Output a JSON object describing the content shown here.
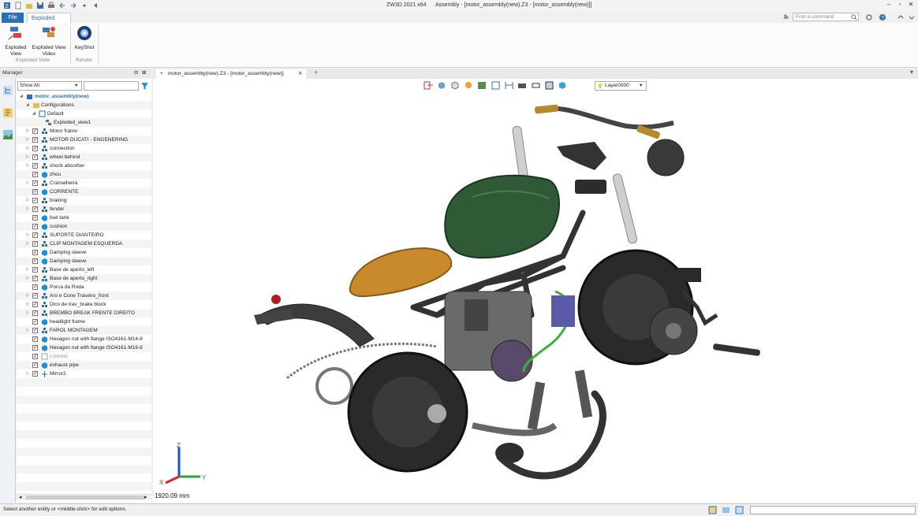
{
  "window": {
    "app_title": "ZW3D 2021 x64",
    "doc_title": "Assembly - [motor_assembly(new).Z3 - [motor_assembly(new)]]"
  },
  "ribbon": {
    "tabs": [
      {
        "label": "File"
      },
      {
        "label": "Exploded View"
      }
    ],
    "search_placeholder": "Find a command",
    "buttons": [
      {
        "label": "Exploded View View"
      },
      {
        "label": "Exploded View Video"
      },
      {
        "label": "KeyShot"
      }
    ],
    "btn1_line1": "Exploded",
    "btn1_line2": "View",
    "btn2_line1": "Exploded View",
    "btn2_line2": "Video",
    "btn3_line1": "KeyShot",
    "groups": [
      {
        "label": "Exploded View"
      },
      {
        "label": "Render"
      }
    ]
  },
  "manager": {
    "title": "Manager",
    "filter_value": "Show All",
    "tree": [
      {
        "label": "motor_assembly(new)",
        "level": 0,
        "check": false,
        "icon": "assembly-root-icon",
        "expand": "open"
      },
      {
        "label": "Configurations",
        "level": 1,
        "check": false,
        "icon": "folder-icon",
        "expand": "open"
      },
      {
        "label": "Default",
        "level": 2,
        "check": false,
        "icon": "config-icon",
        "expand": "open"
      },
      {
        "label": "Exploded_view1",
        "level": 3,
        "check": false,
        "icon": "exploded-view-icon",
        "expand": "none"
      },
      {
        "label": "Motor frame",
        "level": 1,
        "check": true,
        "icon": "subassembly-icon",
        "expand": "closed"
      },
      {
        "label": "MOTOR DUCATI - ENGENERING",
        "level": 1,
        "check": true,
        "icon": "subassembly-icon",
        "expand": "closed"
      },
      {
        "label": "connection",
        "level": 1,
        "check": true,
        "icon": "subassembly-icon",
        "expand": "closed"
      },
      {
        "label": "wheel behind",
        "level": 1,
        "check": true,
        "icon": "subassembly-icon",
        "expand": "closed"
      },
      {
        "label": "shock absorber",
        "level": 1,
        "check": true,
        "icon": "subassembly-icon",
        "expand": "closed"
      },
      {
        "label": "zhou",
        "level": 1,
        "check": true,
        "icon": "part-icon",
        "expand": "none"
      },
      {
        "label": "Cramalheira",
        "level": 1,
        "check": true,
        "icon": "subassembly-icon",
        "expand": "closed"
      },
      {
        "label": "CORRENTE",
        "level": 1,
        "check": true,
        "icon": "part-icon",
        "expand": "none"
      },
      {
        "label": "braking",
        "level": 1,
        "check": true,
        "icon": "subassembly-icon",
        "expand": "closed"
      },
      {
        "label": "fender",
        "level": 1,
        "check": true,
        "icon": "subassembly-icon",
        "expand": "closed"
      },
      {
        "label": "fuel tank",
        "level": 1,
        "check": true,
        "icon": "part-icon",
        "expand": "none"
      },
      {
        "label": "cushion",
        "level": 1,
        "check": true,
        "icon": "part-icon",
        "expand": "none"
      },
      {
        "label": "SUPORTE DIANTEIRO",
        "level": 1,
        "check": true,
        "icon": "subassembly-icon",
        "expand": "closed"
      },
      {
        "label": "CLIP MONTAGEM ESQUERDA",
        "level": 1,
        "check": true,
        "icon": "subassembly-icon",
        "expand": "closed"
      },
      {
        "label": "Damping sleeve",
        "level": 1,
        "check": true,
        "icon": "part-icon",
        "expand": "none"
      },
      {
        "label": "Damping sleeve",
        "level": 1,
        "check": true,
        "icon": "part-icon",
        "expand": "none"
      },
      {
        "label": "Base de aperto_left",
        "level": 1,
        "check": true,
        "icon": "subassembly-icon",
        "expand": "closed"
      },
      {
        "label": "Base de aperto_right",
        "level": 1,
        "check": true,
        "icon": "subassembly-icon",
        "expand": "closed"
      },
      {
        "label": "Porca da Roda",
        "level": 1,
        "check": true,
        "icon": "part-icon",
        "expand": "none"
      },
      {
        "label": "Aro e Cone Traseiro_front",
        "level": 1,
        "check": true,
        "icon": "subassembly-icon",
        "expand": "closed"
      },
      {
        "label": "Dico de trav_brake block",
        "level": 1,
        "check": true,
        "icon": "subassembly-icon",
        "expand": "closed"
      },
      {
        "label": "BREMBO BREAK FRENTE DIREITO",
        "level": 1,
        "check": true,
        "icon": "subassembly-icon",
        "expand": "closed"
      },
      {
        "label": "headlight frame",
        "level": 1,
        "check": true,
        "icon": "part-icon",
        "expand": "none"
      },
      {
        "label": "FAROL MONTAGEM",
        "level": 1,
        "check": true,
        "icon": "subassembly-icon",
        "expand": "closed"
      },
      {
        "label": "Hexagon nut with flange ISO4161-M14-8",
        "level": 1,
        "check": true,
        "icon": "part-icon",
        "expand": "none"
      },
      {
        "label": "Hexagon nut with flange ISO4161-M16-8",
        "level": 1,
        "check": true,
        "icon": "part-icon",
        "expand": "none"
      },
      {
        "label": "(-)street",
        "level": 1,
        "check": true,
        "icon": "sketch-icon",
        "expand": "none"
      },
      {
        "label": "exhaust pipe",
        "level": 1,
        "check": true,
        "icon": "part-icon",
        "expand": "none"
      },
      {
        "label": "Mirror2",
        "level": 1,
        "check": true,
        "icon": "mirror-icon",
        "expand": "closed"
      }
    ]
  },
  "document": {
    "tab_label": "motor_assembly(new).Z3 - [motor_assembly(new)]",
    "layer_value": "Layer0000",
    "scale_text": "1920.09 mm",
    "triad": {
      "x": "X",
      "y": "Y",
      "z": "Z"
    }
  },
  "status": {
    "text": "Select another entity or <middle-click> for edit options."
  },
  "colors": {
    "accent": "#2b6fb8",
    "tank_green": "#2f5a35",
    "seat_orange": "#c98a2e",
    "tire_black": "#2a2a2a"
  }
}
